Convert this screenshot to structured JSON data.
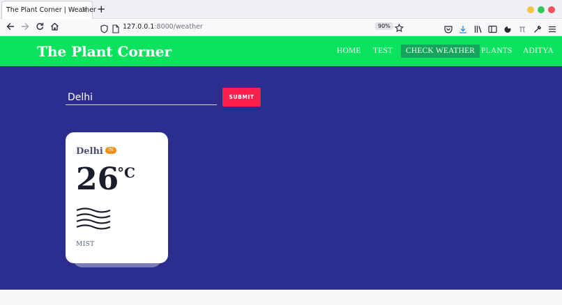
{
  "browser": {
    "tab_title": "The Plant Corner | Weather",
    "tab_close": "×",
    "new_tab": "+",
    "url_host": "127.0.0.1",
    "url_rest": ":8000/weather",
    "zoom": "90%",
    "window_buttons": {
      "minimize": "#f6c343",
      "maximize": "#30c758",
      "close": "#f2525f"
    },
    "toolbar_icons": [
      "pocket-icon",
      "downloads-icon",
      "library-icon",
      "sidebar-icon",
      "extension-icon",
      "extension-icon",
      "eyedropper-icon",
      "menu-icon"
    ]
  },
  "site": {
    "brand": "The Plant Corner",
    "header_color": "#0be35f",
    "main_bg": "#2b2d8f",
    "menu": [
      {
        "label": "HOME",
        "active": false
      },
      {
        "label": "TEST",
        "active": false
      },
      {
        "label": "CHECK WEATHER",
        "active": true
      },
      {
        "label": "PLANTS",
        "active": false
      },
      {
        "label": "ADITYA",
        "active": false
      }
    ]
  },
  "search": {
    "value": "Delhi",
    "submit_label": "SUBMIT",
    "submit_color": "#ff1f4e"
  },
  "weather_card": {
    "city": "Delhi",
    "country": "IN",
    "temperature": "26",
    "unit": "°C",
    "icon": "mist-icon",
    "condition": "MIST"
  }
}
